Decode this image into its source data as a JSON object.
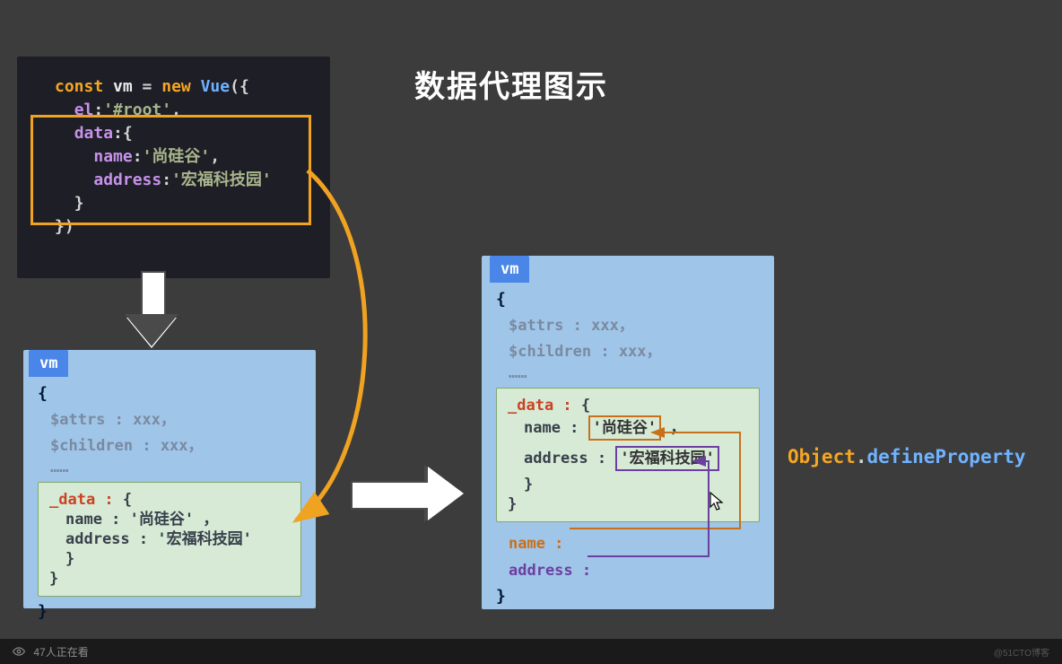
{
  "title": "数据代理图示",
  "code": {
    "l1_const": "const",
    "l1_vm": " vm ",
    "l1_eq": "= ",
    "l1_new": "new ",
    "l1_class": "Vue",
    "l1_paren": "({",
    "l2_prop": "el",
    "l2_colon": ":",
    "l2_val": "'#root'",
    "l2_comma": ",",
    "l3_prop": "data",
    "l3_colon": ":",
    "l3_brace": "{",
    "l4_prop": "name",
    "l4_colon": ":",
    "l4_val": "'尚硅谷'",
    "l4_comma": ",",
    "l5_prop": "address",
    "l5_colon": ":",
    "l5_val": "'宏福科技园'",
    "l6": "}",
    "l7": "})"
  },
  "vm1": {
    "tab": "vm",
    "open": "{",
    "attrs": "$attrs : xxx，",
    "children": "$children : xxx，",
    "dots": "……",
    "data_label": "_data :",
    "data_open": " {",
    "name_line": "name : '尚硅谷' ，",
    "addr_line": "address : '宏福科技园'",
    "data_close1": "}",
    "data_close2": "}",
    "close": "}"
  },
  "vm2": {
    "tab": "vm",
    "open": "{",
    "attrs": "$attrs : xxx，",
    "children": "$children : xxx，",
    "dots": "……",
    "data_label": "_data :",
    "data_open": " {",
    "name_key": "name : ",
    "name_val": "'尚硅谷'",
    "name_comma": " ，",
    "addr_key": "address : ",
    "addr_val": "'宏福科技园'",
    "data_close1": "}",
    "data_close2": "}",
    "vm_name_label": "name :",
    "vm_addr_label": "address :",
    "close": "}"
  },
  "odp": {
    "object": "Object",
    "dot": ".",
    "method": "defineProperty"
  },
  "bottom": {
    "viewer_count": "47",
    "viewer_text": "人正在看",
    "credit": "@51CTO博客"
  }
}
